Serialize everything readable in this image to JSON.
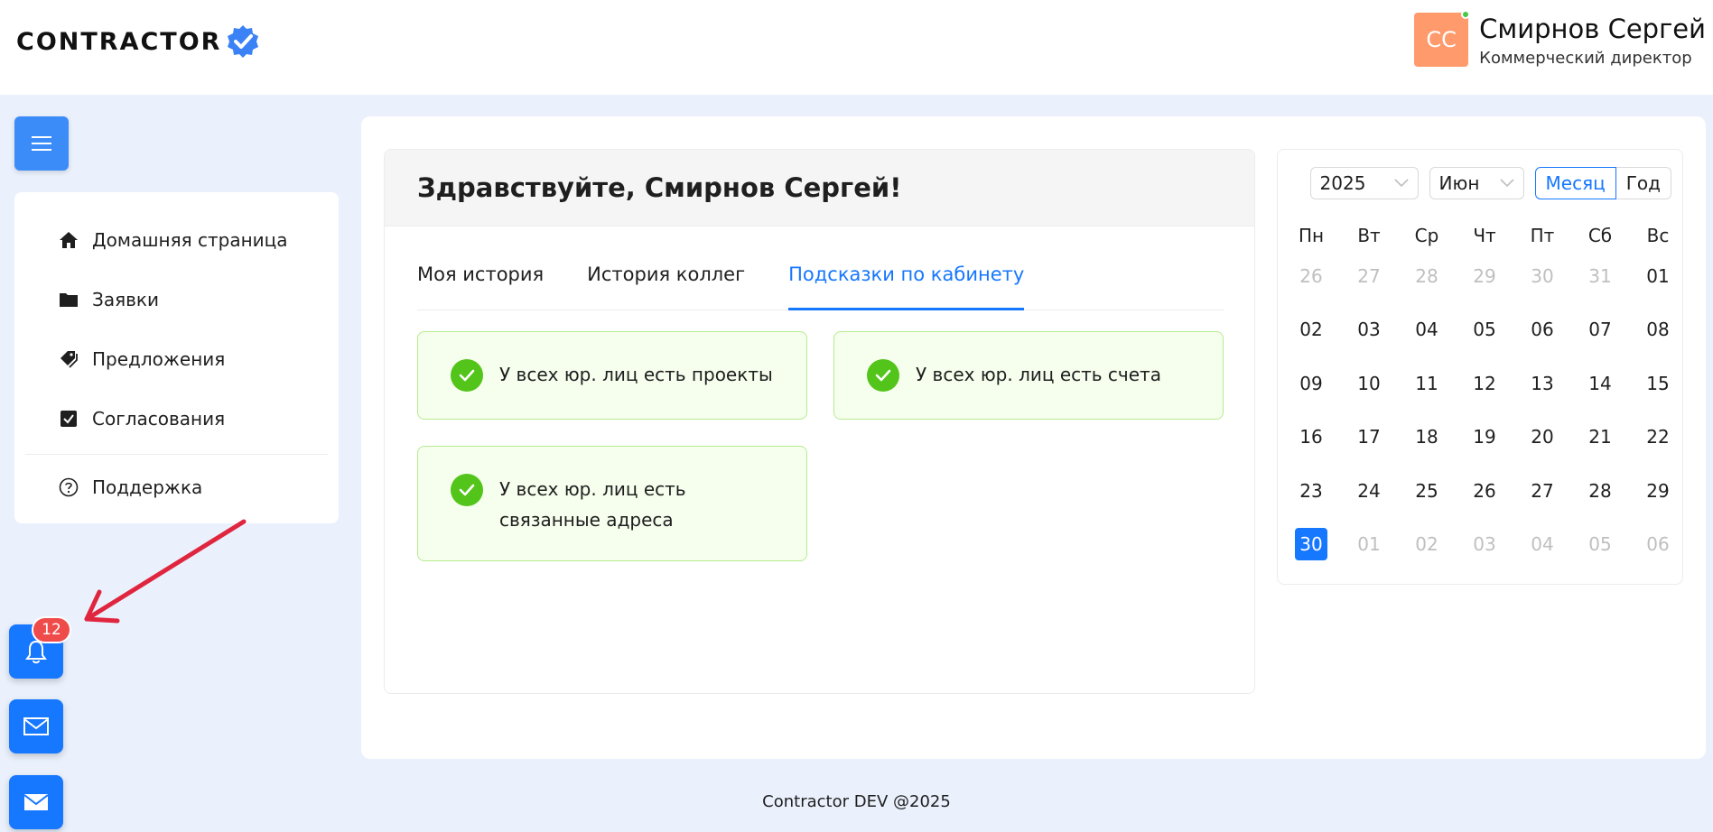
{
  "header": {
    "logo_text": "CONTRACTOR",
    "user": {
      "initials": "СС",
      "name": "Смирнов Сергей",
      "role": "Коммерческий директор"
    }
  },
  "sidebar": {
    "items": [
      {
        "label": "Домашняя страница",
        "icon": "home-icon"
      },
      {
        "label": "Заявки",
        "icon": "folder-icon"
      },
      {
        "label": "Предложения",
        "icon": "tags-icon"
      },
      {
        "label": "Согласования",
        "icon": "checkbox-icon"
      }
    ],
    "support_label": "Поддержка"
  },
  "floating": {
    "notifications_count": "12"
  },
  "welcome": {
    "title": "Здравствуйте, Смирнов Сергей!",
    "tabs": [
      {
        "label": "Моя история"
      },
      {
        "label": "История коллег"
      },
      {
        "label": "Подсказки по кабинету"
      }
    ],
    "hints": [
      {
        "text": "У всех юр. лиц есть проекты"
      },
      {
        "text": "У всех юр. лиц есть счета"
      },
      {
        "text": "У всех юр. лиц есть связанные адреса"
      }
    ]
  },
  "calendar": {
    "year": "2025",
    "month": "Июн",
    "mode_month": "Месяц",
    "mode_year": "Год",
    "weekdays": [
      "Пн",
      "Вт",
      "Ср",
      "Чт",
      "Пт",
      "Сб",
      "Вс"
    ],
    "weeks": [
      [
        "26",
        "27",
        "28",
        "29",
        "30",
        "31",
        "01"
      ],
      [
        "02",
        "03",
        "04",
        "05",
        "06",
        "07",
        "08"
      ],
      [
        "09",
        "10",
        "11",
        "12",
        "13",
        "14",
        "15"
      ],
      [
        "16",
        "17",
        "18",
        "19",
        "20",
        "21",
        "22"
      ],
      [
        "23",
        "24",
        "25",
        "26",
        "27",
        "28",
        "29"
      ],
      [
        "30",
        "01",
        "02",
        "03",
        "04",
        "05",
        "06"
      ]
    ],
    "selected": "30"
  },
  "footer": {
    "text": "Contractor DEV @2025"
  },
  "colors": {
    "accent": "#1677ff",
    "success": "#52c41a",
    "badge": "#f04b4b",
    "avatar": "#ff9a6c"
  }
}
